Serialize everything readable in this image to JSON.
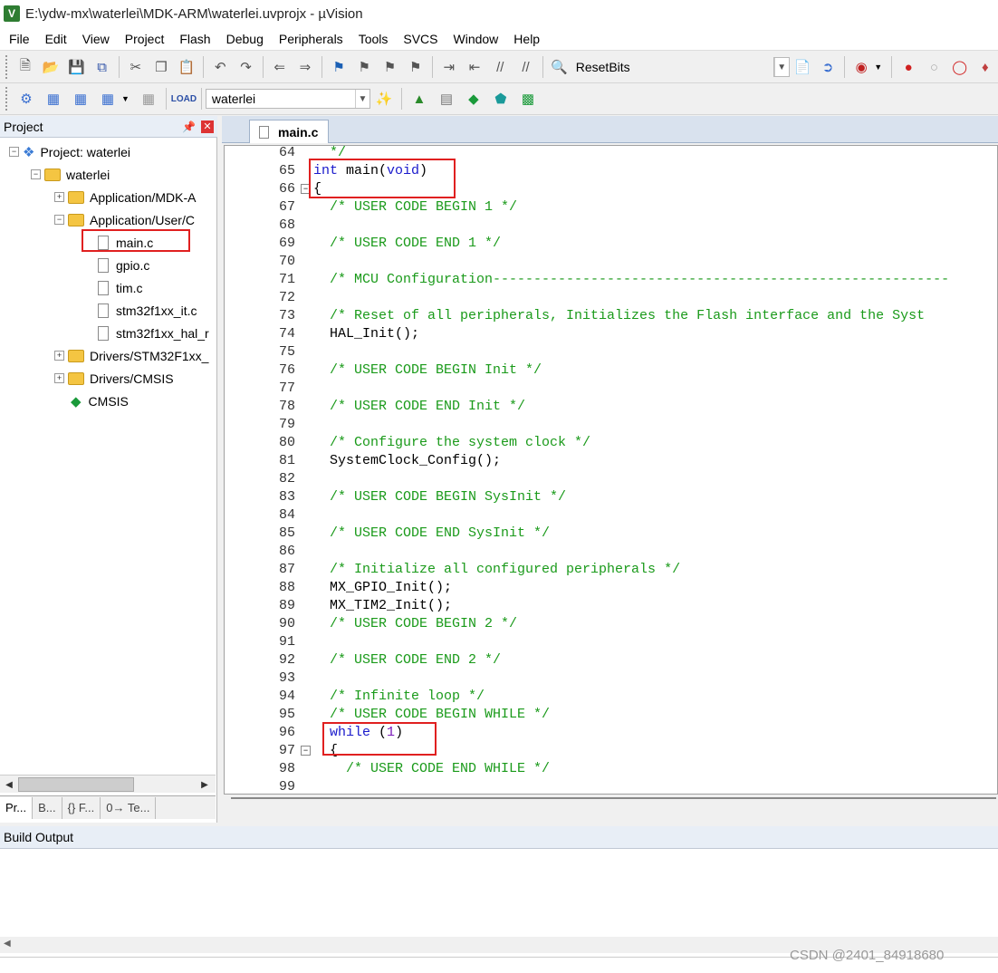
{
  "window": {
    "title": "E:\\ydw-mx\\waterlei\\MDK-ARM\\waterlei.uvprojx - µVision",
    "app_icon": "V"
  },
  "menu": [
    "File",
    "Edit",
    "View",
    "Project",
    "Flash",
    "Debug",
    "Peripherals",
    "Tools",
    "SVCS",
    "Window",
    "Help"
  ],
  "toolbar1": {
    "resetbits_label": "ResetBits"
  },
  "toolbar2": {
    "target_combo": "waterlei"
  },
  "project_panel": {
    "title": "Project",
    "tree": [
      {
        "label": "Project: waterlei"
      },
      {
        "label": "waterlei"
      },
      {
        "label": "Application/MDK-A"
      },
      {
        "label": "Application/User/C"
      },
      {
        "label": "main.c"
      },
      {
        "label": "gpio.c"
      },
      {
        "label": "tim.c"
      },
      {
        "label": "stm32f1xx_it.c"
      },
      {
        "label": "stm32f1xx_hal_r"
      },
      {
        "label": "Drivers/STM32F1xx_"
      },
      {
        "label": "Drivers/CMSIS"
      },
      {
        "label": "CMSIS"
      }
    ],
    "tabs": [
      "Pr...",
      "B...",
      "{} F...",
      "0→ Te..."
    ]
  },
  "editor": {
    "tab_label": "main.c",
    "lines": [
      {
        "n": "64",
        "text": "  */",
        "cls": "cmt"
      },
      {
        "n": "65",
        "text": "int main(void)",
        "cls": "mixed1"
      },
      {
        "n": "66",
        "text": "{",
        "cls": "plain"
      },
      {
        "n": "67",
        "text": "  /* USER CODE BEGIN 1 */",
        "cls": "cmt"
      },
      {
        "n": "68",
        "text": "",
        "cls": "plain"
      },
      {
        "n": "69",
        "text": "  /* USER CODE END 1 */",
        "cls": "cmt"
      },
      {
        "n": "70",
        "text": "",
        "cls": "plain"
      },
      {
        "n": "71",
        "text": "  /* MCU Configuration--------------------------------------------------------",
        "cls": "cmt"
      },
      {
        "n": "72",
        "text": "",
        "cls": "plain"
      },
      {
        "n": "73",
        "text": "  /* Reset of all peripherals, Initializes the Flash interface and the Syst",
        "cls": "cmt"
      },
      {
        "n": "74",
        "text": "  HAL_Init();",
        "cls": "plain"
      },
      {
        "n": "75",
        "text": "",
        "cls": "plain"
      },
      {
        "n": "76",
        "text": "  /* USER CODE BEGIN Init */",
        "cls": "cmt"
      },
      {
        "n": "77",
        "text": "",
        "cls": "plain"
      },
      {
        "n": "78",
        "text": "  /* USER CODE END Init */",
        "cls": "cmt"
      },
      {
        "n": "79",
        "text": "",
        "cls": "plain"
      },
      {
        "n": "80",
        "text": "  /* Configure the system clock */",
        "cls": "cmt"
      },
      {
        "n": "81",
        "text": "  SystemClock_Config();",
        "cls": "plain"
      },
      {
        "n": "82",
        "text": "",
        "cls": "plain"
      },
      {
        "n": "83",
        "text": "  /* USER CODE BEGIN SysInit */",
        "cls": "cmt"
      },
      {
        "n": "84",
        "text": "",
        "cls": "plain"
      },
      {
        "n": "85",
        "text": "  /* USER CODE END SysInit */",
        "cls": "cmt"
      },
      {
        "n": "86",
        "text": "",
        "cls": "plain"
      },
      {
        "n": "87",
        "text": "  /* Initialize all configured peripherals */",
        "cls": "cmt"
      },
      {
        "n": "88",
        "text": "  MX_GPIO_Init();",
        "cls": "plain"
      },
      {
        "n": "89",
        "text": "  MX_TIM2_Init();",
        "cls": "plain"
      },
      {
        "n": "90",
        "text": "  /* USER CODE BEGIN 2 */",
        "cls": "cmt"
      },
      {
        "n": "91",
        "text": "",
        "cls": "plain"
      },
      {
        "n": "92",
        "text": "  /* USER CODE END 2 */",
        "cls": "cmt"
      },
      {
        "n": "93",
        "text": "",
        "cls": "plain"
      },
      {
        "n": "94",
        "text": "  /* Infinite loop */",
        "cls": "cmt"
      },
      {
        "n": "95",
        "text": "  /* USER CODE BEGIN WHILE */",
        "cls": "cmt"
      },
      {
        "n": "96",
        "text": "  while (1)",
        "cls": "mixed2"
      },
      {
        "n": "97",
        "text": "  {",
        "cls": "plain"
      },
      {
        "n": "98",
        "text": "    /* USER CODE END WHILE */",
        "cls": "cmt"
      },
      {
        "n": "99",
        "text": "",
        "cls": "plain"
      }
    ]
  },
  "build_output": {
    "title": "Build Output"
  },
  "watermark": "CSDN @2401_84918680",
  "colors": {
    "comment": "#1a9a1a",
    "keyword": "#1a1acc",
    "number": "#7a1ab8",
    "annotation": "#e02020"
  }
}
